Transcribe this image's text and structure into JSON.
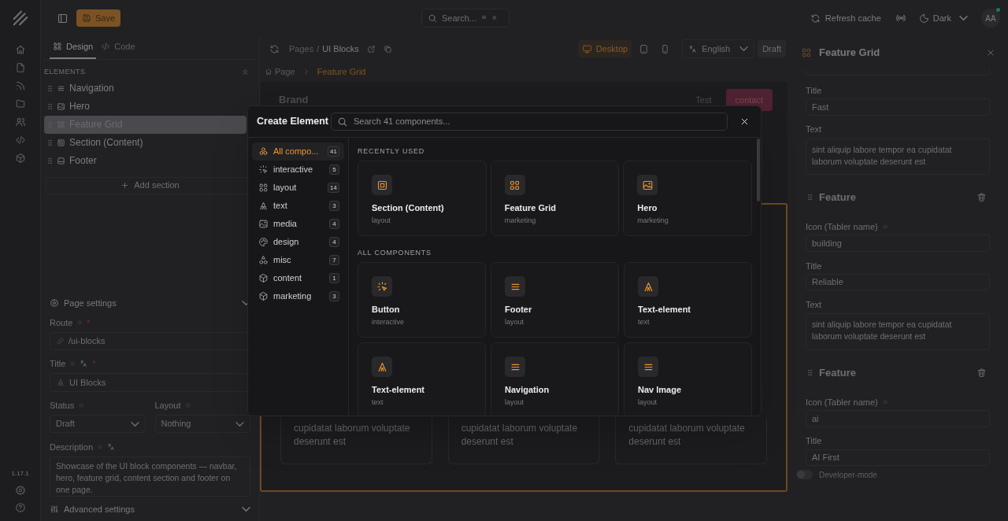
{
  "top_bar": {
    "save_label": "Save",
    "search": {
      "placeholder": "Search...",
      "keys": [
        "⌘",
        "K"
      ]
    },
    "refresh_label": "Refresh cache",
    "theme_label": "Dark",
    "avatar": "AA",
    "online": true
  },
  "rail": {
    "version": "1.17.1"
  },
  "left_panel": {
    "tabs": [
      {
        "label": "Design",
        "kind": "grid",
        "selected": true
      },
      {
        "label": "Code",
        "kind": "code",
        "selected": false
      }
    ],
    "elements_heading": "ELEMENTS",
    "elements": [
      {
        "label": "Navigation",
        "kind": "lines",
        "selected": false
      },
      {
        "label": "Hero",
        "kind": "image",
        "selected": false
      },
      {
        "label": "Feature Grid",
        "kind": "grid",
        "selected": true
      },
      {
        "label": "Section (Content)",
        "kind": "section",
        "selected": false
      },
      {
        "label": "Footer",
        "kind": "footer",
        "selected": false
      }
    ],
    "add_section_label": "Add section",
    "page_settings": {
      "title": "Page settings",
      "route": {
        "label": "Route",
        "info": true,
        "translatable": false,
        "required_mark": "*",
        "value": "/ui-blocks"
      },
      "title_field": {
        "label": "Title",
        "info": true,
        "translatable": true,
        "required_mark": "*",
        "value": "UI Blocks"
      },
      "status": {
        "label": "Status",
        "info": true,
        "value": "Draft"
      },
      "layout": {
        "label": "Layout",
        "info": true,
        "value": "Nothing"
      },
      "description": {
        "label": "Description",
        "info": true,
        "translatable": true,
        "value": "Showcase of the UI block components — navbar, hero, feature grid, content section and footer on one page."
      },
      "advanced_label": "Advanced settings"
    }
  },
  "editor": {
    "path": {
      "parent": "Pages",
      "separator": "/",
      "current": "UI Blocks"
    },
    "devices": [
      {
        "kind": "desktop",
        "label": "Desktop",
        "selected": true
      },
      {
        "kind": "tablet",
        "selected": false
      },
      {
        "kind": "mobile",
        "selected": false
      }
    ],
    "language": "English",
    "status": "Draft",
    "breadcrumb": [
      "Page",
      "Feature Grid"
    ],
    "preview": {
      "brand": "Brand",
      "nav_links": [
        "Test"
      ],
      "cta": "contact",
      "cards": [
        {
          "text": "cupidatat laborum voluptate deserunt est"
        },
        {
          "text": "cupidatat laborum voluptate deserunt est"
        },
        {
          "text": "cupidatat laborum voluptate deserunt est"
        }
      ]
    }
  },
  "inspector": {
    "title": "Feature Grid",
    "groups": [
      {
        "fields": [
          {
            "label": "Title",
            "kind": "input",
            "info": false,
            "value": "Fast"
          },
          {
            "label": "Text",
            "kind": "textarea",
            "info": false,
            "value": "sint aliquip labore tempor ea cupidatat laborum voluptate deserunt est"
          }
        ]
      },
      {
        "heading": "Feature",
        "fields": [
          {
            "label": "Icon (Tabler name)",
            "kind": "input",
            "info": true,
            "value": "building"
          },
          {
            "label": "Title",
            "kind": "input",
            "info": false,
            "value": "Reliable"
          },
          {
            "label": "Text",
            "kind": "textarea",
            "info": false,
            "value": "sint aliquip labore tempor ea cupidatat laborum voluptate deserunt est"
          }
        ]
      },
      {
        "heading": "Feature",
        "fields": [
          {
            "label": "Icon (Tabler name)",
            "kind": "input",
            "info": true,
            "value": "ai"
          },
          {
            "label": "Title",
            "kind": "input",
            "info": false,
            "value": "AI First"
          }
        ]
      }
    ],
    "developer_mode": {
      "label": "Developer-mode",
      "on": false
    }
  },
  "dialog": {
    "title": "Create Element",
    "search_placeholder": "Search 41 components...",
    "categories": [
      {
        "label": "All compo...",
        "kind": "all",
        "count": "41",
        "selected": true
      },
      {
        "label": "interactive",
        "kind": "cursor",
        "count": "5",
        "selected": false
      },
      {
        "label": "layout",
        "kind": "grid",
        "count": "14",
        "selected": false
      },
      {
        "label": "text",
        "kind": "letter",
        "count": "3",
        "selected": false
      },
      {
        "label": "media",
        "kind": "image",
        "count": "4",
        "selected": false
      },
      {
        "label": "design",
        "kind": "palette",
        "count": "4",
        "selected": false
      },
      {
        "label": "misc",
        "kind": "shapes",
        "count": "7",
        "selected": false
      },
      {
        "label": "content",
        "kind": "cube",
        "count": "1",
        "selected": false
      },
      {
        "label": "marketing",
        "kind": "cube",
        "count": "3",
        "selected": false
      }
    ],
    "recent_heading": "RECENTLY USED",
    "recent": [
      {
        "name": "Section (Content)",
        "category": "layout",
        "kind": "section"
      },
      {
        "name": "Feature Grid",
        "category": "marketing",
        "kind": "grid"
      },
      {
        "name": "Hero",
        "category": "marketing",
        "kind": "image"
      }
    ],
    "all_heading": "ALL COMPONENTS",
    "all": [
      {
        "name": "Button",
        "category": "interactive",
        "kind": "cursor"
      },
      {
        "name": "Footer",
        "category": "layout",
        "kind": "lines"
      },
      {
        "name": "Text-element",
        "category": "text",
        "kind": "letter"
      },
      {
        "name": "Text-element",
        "category": "text",
        "kind": "letter"
      },
      {
        "name": "Navigation",
        "category": "layout",
        "kind": "lines"
      },
      {
        "name": "Nav Image",
        "category": "layout",
        "kind": "lines"
      }
    ]
  }
}
